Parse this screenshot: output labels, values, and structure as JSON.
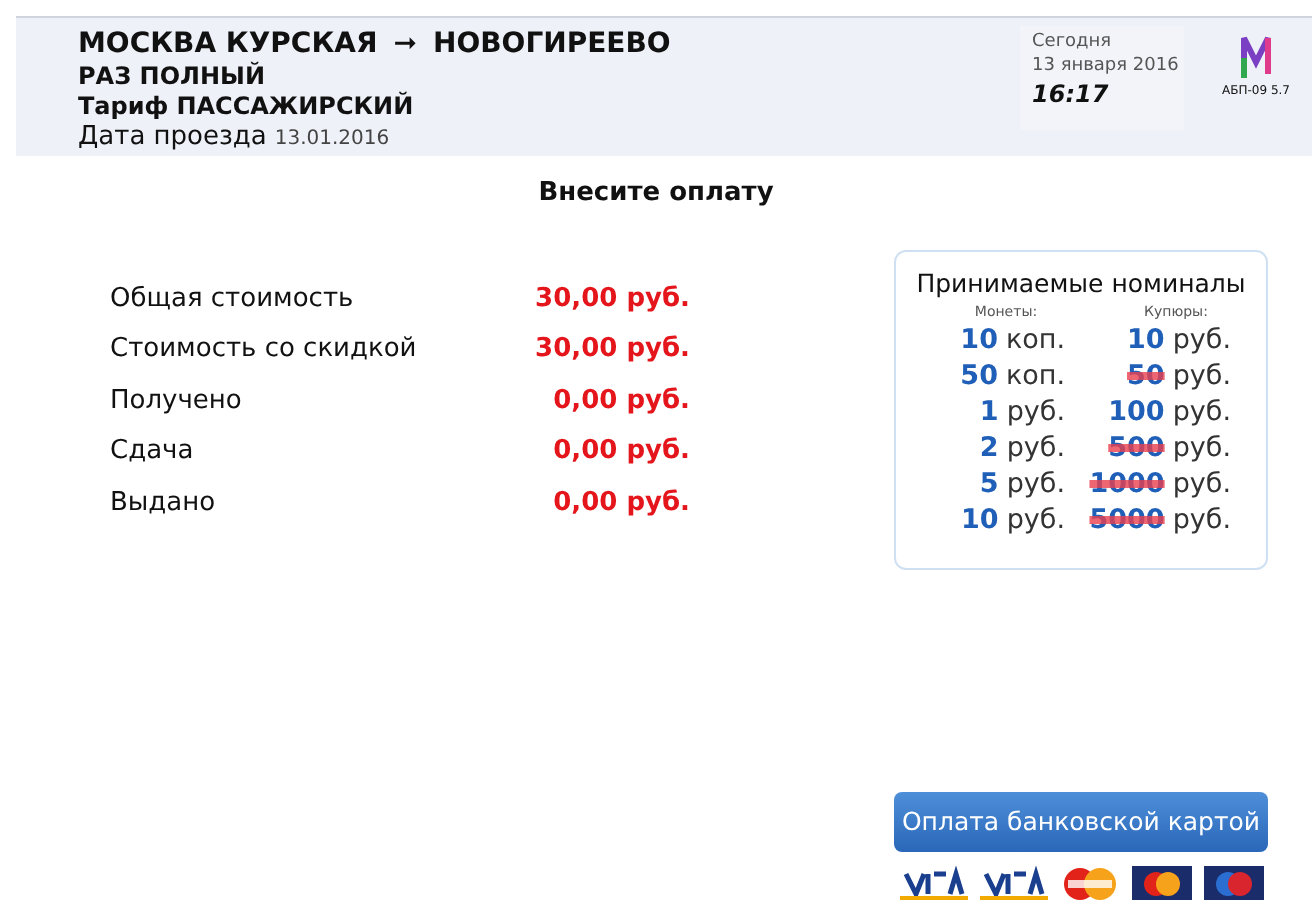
{
  "header": {
    "from": "МОСКВА КУРСКАЯ",
    "arrow": "➞",
    "to": "НОВОГИРЕЕВО",
    "ticket": "РАЗ ПОЛНЫЙ",
    "tariff_label": "Тариф",
    "tariff": "ПАССАЖИРСКИЙ",
    "date_label": "Дата проезда",
    "date": "13.01.2016"
  },
  "clock": {
    "label": "Сегодня",
    "date": "13 января 2016",
    "time": "16:17"
  },
  "device": {
    "code": "АБП-09 5.7"
  },
  "title": "Внесите оплату",
  "summary": [
    {
      "label": "Общая стоимость",
      "value": "30,00 руб."
    },
    {
      "label": "Стоимость со скидкой",
      "value": "30,00 руб."
    },
    {
      "label": "Получено",
      "value": "0,00 руб."
    },
    {
      "label": "Сдача",
      "value": "0,00 руб."
    },
    {
      "label": "Выдано",
      "value": "0,00 руб."
    }
  ],
  "denominations": {
    "title": "Принимаемые номиналы",
    "coins_label": "Монеты:",
    "bills_label": "Купюры:",
    "coins": [
      {
        "amount": "10",
        "unit": "коп.",
        "accepted": true
      },
      {
        "amount": "50",
        "unit": "коп.",
        "accepted": true
      },
      {
        "amount": "1",
        "unit": "руб.",
        "accepted": true
      },
      {
        "amount": "2",
        "unit": "руб.",
        "accepted": true
      },
      {
        "amount": "5",
        "unit": "руб.",
        "accepted": true
      },
      {
        "amount": "10",
        "unit": "руб.",
        "accepted": true
      }
    ],
    "bills": [
      {
        "amount": "10",
        "unit": "руб.",
        "accepted": true
      },
      {
        "amount": "50",
        "unit": "руб.",
        "accepted": false
      },
      {
        "amount": "100",
        "unit": "руб.",
        "accepted": true
      },
      {
        "amount": "500",
        "unit": "руб.",
        "accepted": false
      },
      {
        "amount": "1000",
        "unit": "руб.",
        "accepted": false
      },
      {
        "amount": "5000",
        "unit": "руб.",
        "accepted": false
      }
    ]
  },
  "card_button": "Оплата банковской картой",
  "card_logos": [
    {
      "kind": "visa"
    },
    {
      "kind": "visa"
    },
    {
      "kind": "mastercard"
    },
    {
      "kind": "maestro"
    },
    {
      "kind": "maestro-blue"
    }
  ]
}
